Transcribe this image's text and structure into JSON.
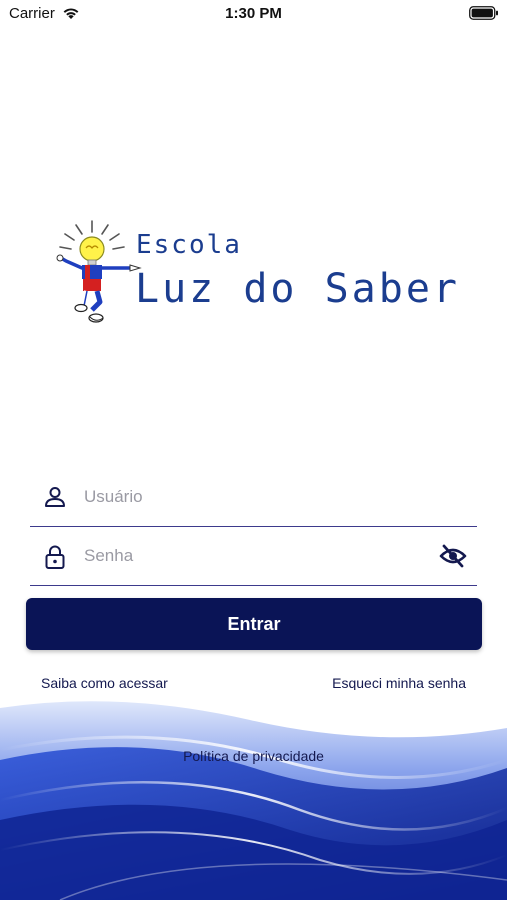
{
  "status_bar": {
    "carrier": "Carrier",
    "time": "1:30 PM",
    "icons": [
      "wifi-icon",
      "battery-icon"
    ]
  },
  "logo": {
    "line1": "Escola",
    "line2": "Luz do Saber"
  },
  "form": {
    "username_placeholder": "Usuário",
    "username_value": "",
    "username_icon": "user-icon",
    "password_placeholder": "Senha",
    "password_value": "",
    "password_icon": "lock-icon",
    "visibility_icon": "eye-off-icon",
    "submit_label": "Entrar"
  },
  "links": {
    "how_to_access": "Saiba como acessar",
    "forgot_password": "Esqueci minha senha",
    "privacy_policy": "Política de privacidade"
  },
  "colors": {
    "primary": "#0a1456",
    "link": "#14194f",
    "logo_text": "#1b3d8f",
    "wave": "#2b4fc4"
  }
}
